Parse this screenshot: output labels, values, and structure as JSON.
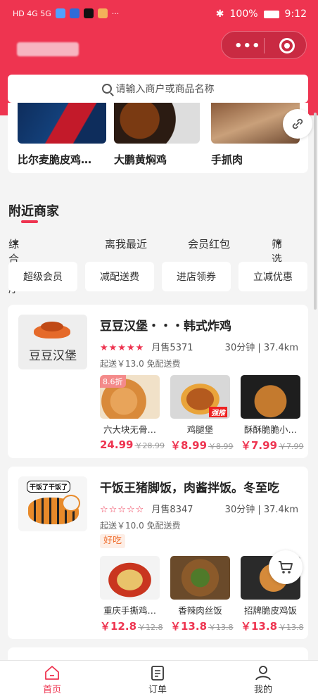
{
  "status_bar": {
    "left": "HD 4G 5G",
    "battery": "100%",
    "time": "9:12",
    "accent": "#ee3450"
  },
  "header": {
    "capsule_more": "•••"
  },
  "search": {
    "placeholder": "请输入商户或商品名称",
    "icon": "search-icon"
  },
  "categories": [
    {
      "label": "比尔麦脆皮鸡…"
    },
    {
      "label": "大鹏黄焖鸡"
    },
    {
      "label": "手抓肉"
    }
  ],
  "nearby": {
    "title": "附近商家",
    "sort": [
      {
        "label": "综合排序"
      },
      {
        "label": "离我最近"
      },
      {
        "label": "会员红包"
      },
      {
        "label": "筛选"
      }
    ],
    "chips": [
      {
        "label": "超级会员"
      },
      {
        "label": "减配送费"
      },
      {
        "label": "进店领券"
      },
      {
        "label": "立减优惠"
      }
    ]
  },
  "stores": [
    {
      "logo_text": "豆豆汉堡",
      "name": "豆豆汉堡・・・韩式炸鸡",
      "stars": "★★★★★",
      "sales": "月售5371",
      "time_distance": "30分钟 | 37.4km",
      "delivery": "起送￥13.0  免配送费",
      "goods": [
        {
          "name": "六大块无骨…",
          "price": "24.99",
          "old": "￥28.99",
          "badge": "8.6折"
        },
        {
          "name": "鸡腿堡",
          "price": "￥8.99",
          "old": "￥8.99",
          "badge": "强推"
        },
        {
          "name": "酥酥脆脆小…",
          "price": "￥7.99",
          "old": "￥7.99"
        }
      ]
    },
    {
      "logo_text": "干饭了干饭了",
      "name": "干饭王猪脚饭，肉酱拌饭。冬至吃",
      "stars": "☆☆☆☆☆",
      "sales": "月售8347",
      "time_distance": "30分钟 | 37.4km",
      "delivery": "起送￥10.0  免配送费",
      "tag": "好吃",
      "goods": [
        {
          "name": "重庆手撕鸡…",
          "price": "￥12.8",
          "old": "￥12.8"
        },
        {
          "name": "香辣肉丝饭",
          "price": "￥13.8",
          "old": "￥13.8"
        },
        {
          "name": "招牌脆皮鸡饭",
          "price": "￥13.8",
          "old": "￥13.8"
        }
      ]
    }
  ],
  "tabbar": [
    {
      "label": "首页",
      "icon": "home-icon",
      "active": true
    },
    {
      "label": "订单",
      "icon": "order-icon"
    },
    {
      "label": "我的",
      "icon": "profile-icon"
    }
  ]
}
